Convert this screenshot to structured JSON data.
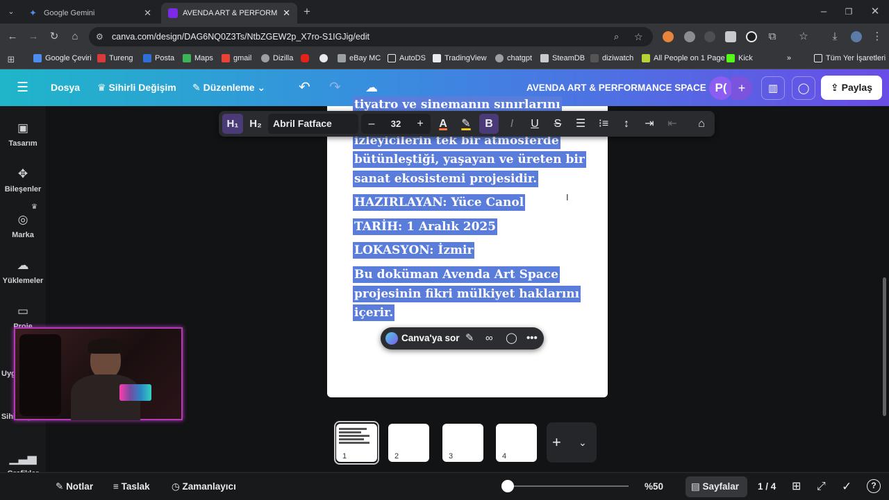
{
  "browser": {
    "tabs": [
      {
        "title": "Google Gemini",
        "favicon_color": "#4f8cf0"
      },
      {
        "title": "AVENDA ART & PERFORMANCE",
        "favicon_color": "#7d2ae8"
      }
    ],
    "new_tab_label": "+",
    "url": "canva.com/design/DAG6NQ0Z3Ts/NtbZGEW2p_X7ro-S1IGJig/edit",
    "bookmarks": [
      "Google Çeviri",
      "Tureng",
      "Posta",
      "Maps",
      "gmail",
      "Dizilla",
      "",
      "",
      "eBay MC",
      "AutoDS",
      "TradingView",
      "chatgpt",
      "SteamDB",
      "diziwatch",
      "All People on 1 Page",
      "Kick"
    ],
    "bookmarks_more": "»",
    "all_bookmarks": "Tüm Yer İşaretleri"
  },
  "canva_header": {
    "file": "Dosya",
    "magic_switch": "Sihirli Değişim",
    "editing": "Düzenleme",
    "design_title": "AVENDA ART & PERFORMANCE SPACE",
    "avatar": "P(",
    "share": "Paylaş"
  },
  "rail": [
    {
      "label": "Tasarım",
      "icon": "layout-icon"
    },
    {
      "label": "Bileşenler",
      "icon": "elements-icon"
    },
    {
      "label": "Marka",
      "icon": "brand-icon"
    },
    {
      "label": "Yüklemeler",
      "icon": "upload-icon"
    },
    {
      "label": "Proje",
      "icon": "folder-icon"
    },
    {
      "label": "Uyg",
      "icon": "apps-icon"
    },
    {
      "label": "Sihirli İçerik",
      "icon": "magic-icon"
    },
    {
      "label": "Grafikler",
      "icon": "charts-icon"
    }
  ],
  "text_toolbar": {
    "h1": "H₁",
    "h2": "H₂",
    "font": "Abril Fatface",
    "minus": "–",
    "size": "32",
    "plus": "+",
    "bold": "B",
    "italic": "I",
    "underline": "U",
    "strike": "S"
  },
  "document": {
    "cut_top": "tiyatro ve sinemanın sınırlarını",
    "lines": [
      "izleyicilerin tek bir atmosferde",
      "bütünleştiği, yaşayan ve üreten bir",
      "sanat ekosistemi projesidir.",
      "HAZIRLAYAN: Yüce Canol",
      "TARİH: 1 Aralık 2025",
      "LOKASYON: İzmir",
      "Bu doküman Avenda Art Space",
      "projesinin fikri mülkiyet haklarını",
      "içerir."
    ],
    "selection_color": "#5a7cdb"
  },
  "ask_bar": {
    "label": "Canva'ya sor"
  },
  "pages": [
    {
      "number": "1",
      "active": true
    },
    {
      "number": "2",
      "active": false
    },
    {
      "number": "3",
      "active": false
    },
    {
      "number": "4",
      "active": false
    }
  ],
  "bottom_bar": {
    "notes": "Notlar",
    "draft": "Taslak",
    "timer": "Zamanlayıcı",
    "zoom": "%50",
    "pages_label": "Sayfalar",
    "page_count": "1 / 4"
  }
}
